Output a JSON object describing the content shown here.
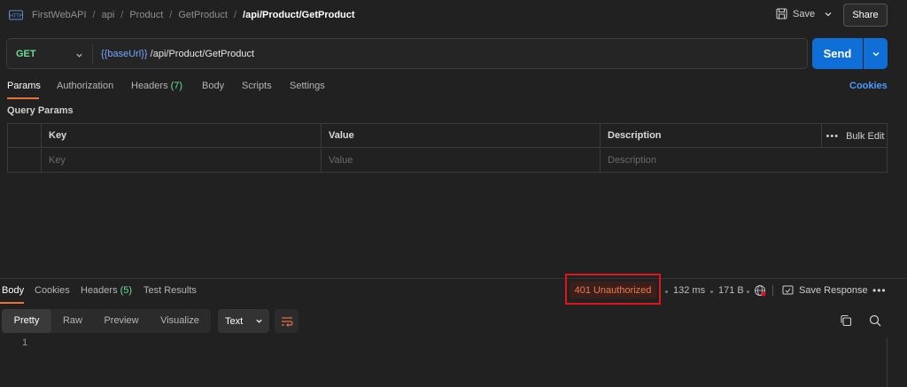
{
  "breadcrumb": {
    "items": [
      "FirstWebAPI",
      "api",
      "Product",
      "GetProduct"
    ],
    "current": "/api/Product/GetProduct",
    "separator": "/"
  },
  "toolbar": {
    "save_label": "Save",
    "share_label": "Share"
  },
  "request": {
    "method": "GET",
    "url_variable": "{{baseUrl}}",
    "url_path": " /api/Product/GetProduct",
    "send_label": "Send"
  },
  "request_tabs": {
    "params": "Params",
    "authorization": "Authorization",
    "headers": "Headers",
    "headers_count": "(7)",
    "body": "Body",
    "scripts": "Scripts",
    "settings": "Settings",
    "cookies": "Cookies"
  },
  "query_params": {
    "label": "Query Params",
    "columns": [
      "Key",
      "Value",
      "Description"
    ],
    "bulk_edit": "Bulk Edit",
    "placeholders": [
      "Key",
      "Value",
      "Description"
    ]
  },
  "response_tabs": {
    "body": "Body",
    "cookies": "Cookies",
    "headers": "Headers",
    "headers_count": "(5)",
    "test_results": "Test Results"
  },
  "response_meta": {
    "status": "401 Unauthorized",
    "time": "132 ms",
    "size": "171 B",
    "save_response": "Save Response"
  },
  "response_view": {
    "modes": [
      "Pretty",
      "Raw",
      "Preview",
      "Visualize"
    ],
    "format": "Text",
    "line_number": "1"
  },
  "colors": {
    "accent_orange": "#e8743b",
    "send_blue": "#0f6fd6",
    "method_green": "#6bdd9a",
    "status_error": "#f2784b",
    "highlight_box": "#e0141c"
  }
}
